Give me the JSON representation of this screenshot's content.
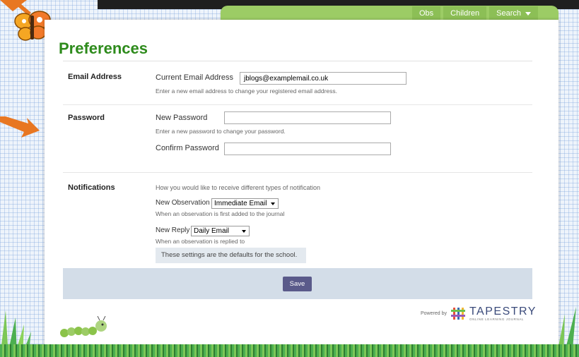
{
  "nav": {
    "items": [
      {
        "label": "Obs"
      },
      {
        "label": "Children"
      },
      {
        "label": "Search"
      }
    ]
  },
  "page": {
    "title": "Preferences"
  },
  "email": {
    "section_label": "Email Address",
    "field_label": "Current Email Address",
    "value": "jblogs@examplemail.co.uk",
    "help": "Enter a new email address to change your registered email address."
  },
  "password": {
    "section_label": "Password",
    "new_label": "New Password",
    "new_help": "Enter a new password to change your password.",
    "confirm_label": "Confirm Password"
  },
  "notifications": {
    "section_label": "Notifications",
    "intro": "How you would like to receive different types of notification",
    "new_observation": {
      "label": "New Observation",
      "selected": "Immediate Email",
      "help": "When an observation is first added to the journal"
    },
    "new_reply": {
      "label": "New Reply",
      "selected": "Daily Email",
      "help": "When an observation is replied to"
    },
    "notice": "These settings are the defaults for the school."
  },
  "actions": {
    "save_label": "Save"
  },
  "footer": {
    "powered_by": "Powered by",
    "brand": "TAPESTRY",
    "brand_sub": "ONLINE LEARNING JOURNAL"
  },
  "colors": {
    "title_green": "#2e8b1c",
    "nav_green": "#8cbf56",
    "save_button": "#5a5a8a",
    "save_bar": "#d3dde8",
    "arrow_orange": "#e87722"
  },
  "icons": [
    "butterfly-icon",
    "arrow-icon",
    "caterpillar-icon",
    "tapestry-logo-icon",
    "chevron-down-icon"
  ]
}
